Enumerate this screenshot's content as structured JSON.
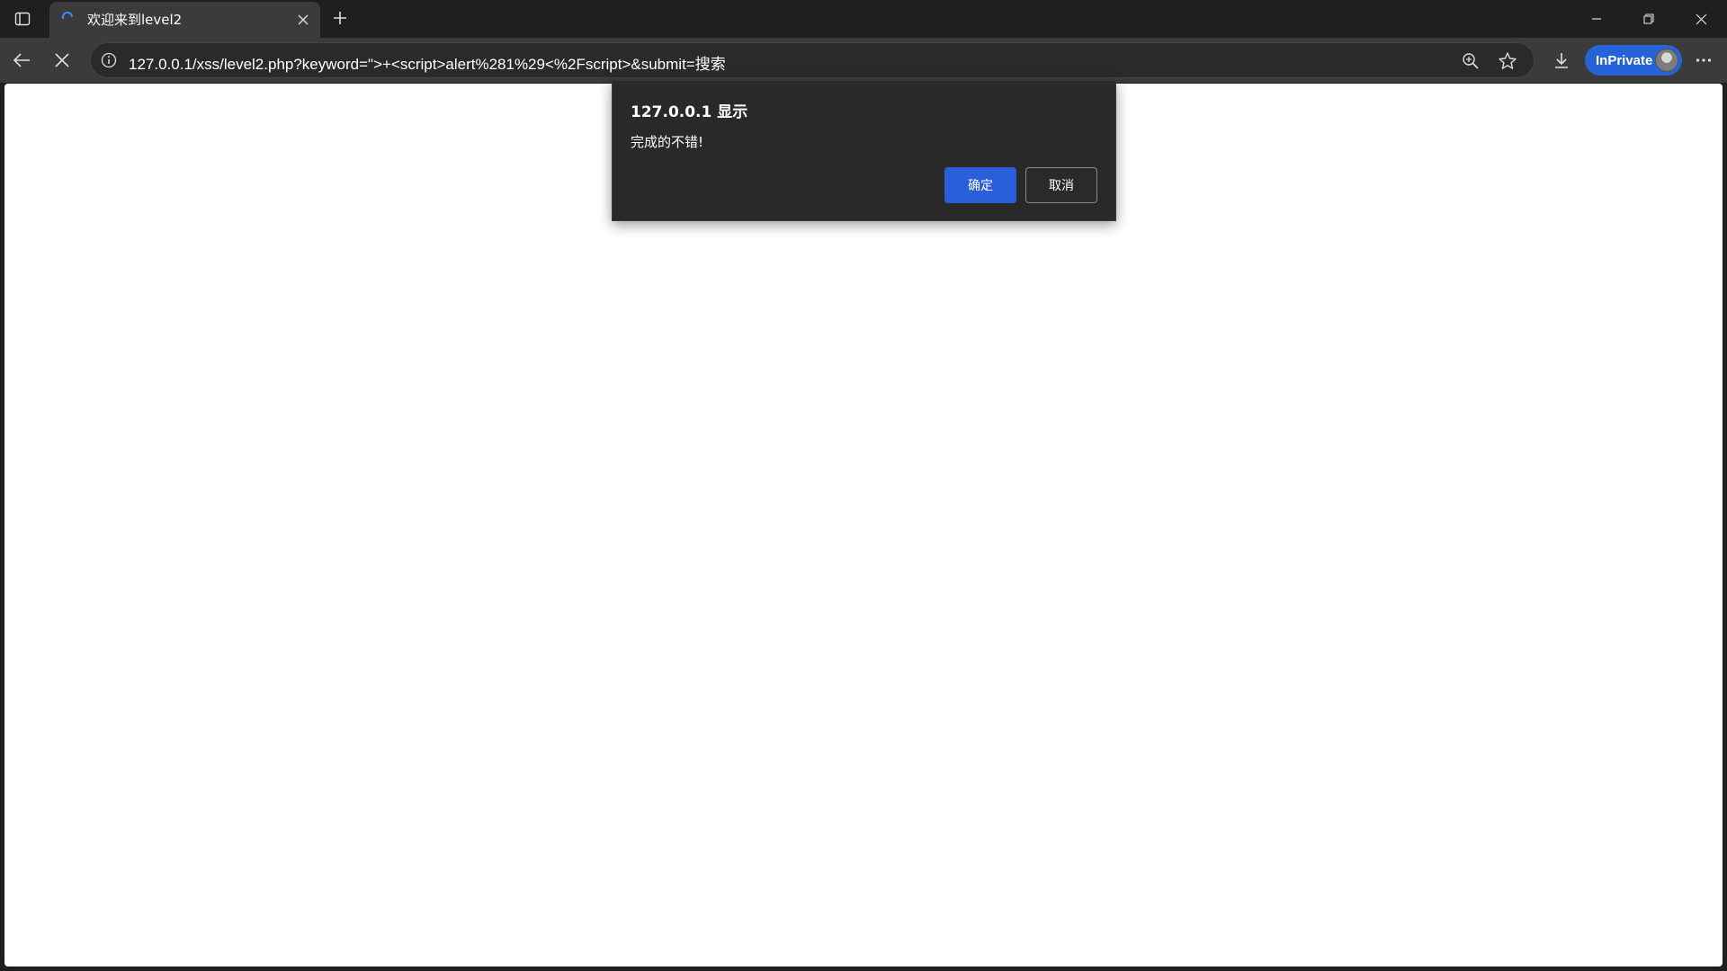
{
  "tab": {
    "title": "欢迎来到level2"
  },
  "address_bar": {
    "url": "127.0.0.1/xss/level2.php?keyword=\">+<script>alert%281%29<%2Fscript>&submit=搜索"
  },
  "profile": {
    "label": "InPrivate"
  },
  "dialog": {
    "title": "127.0.0.1 显示",
    "message": "完成的不错!",
    "ok_label": "确定",
    "cancel_label": "取消"
  },
  "colors": {
    "accent": "#2563d6",
    "dialog_bg": "#292929",
    "chrome_bg": "#1f1f1f",
    "toolbar_bg": "#3b3b3b"
  },
  "icons": {
    "tab_actions": "tab-actions-icon",
    "loading": "loading-spinner-icon",
    "tab_close": "close-icon",
    "new_tab": "plus-icon",
    "minimize": "minimize-icon",
    "maximize": "restore-icon",
    "window_close": "close-icon",
    "back": "back-arrow-icon",
    "stop": "stop-icon",
    "site_info": "info-icon",
    "zoom": "zoom-icon",
    "favorite": "star-icon",
    "download": "download-icon",
    "more": "more-icon"
  }
}
